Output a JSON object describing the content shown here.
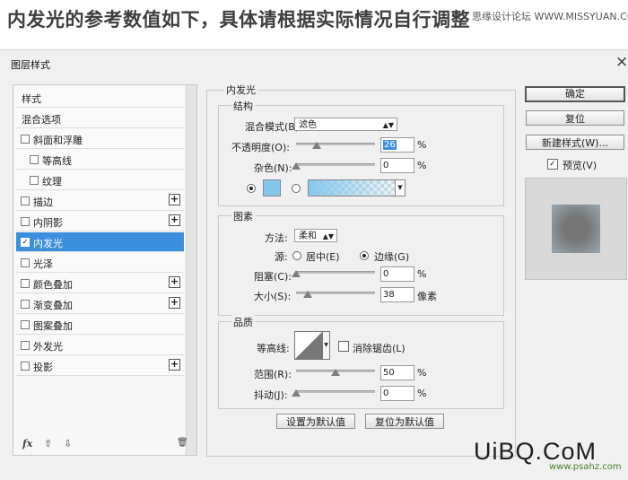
{
  "headline": "内发光的参考数值如下，具体请根据实际情况自行调整",
  "source": "思缘设计论坛 WWW.MISSYUAN.COM",
  "dialog": {
    "title": "图层样式",
    "close": "×"
  },
  "style_list": {
    "items": [
      {
        "label": "样式"
      },
      {
        "label": "混合选项"
      },
      {
        "label": "斜面和浮雕"
      },
      {
        "label": "等高线"
      },
      {
        "label": "纹理"
      },
      {
        "label": "描边"
      },
      {
        "label": "内阴影"
      },
      {
        "label": "内发光"
      },
      {
        "label": "光泽"
      },
      {
        "label": "颜色叠加"
      },
      {
        "label": "渐变叠加"
      },
      {
        "label": "图案叠加"
      },
      {
        "label": "外发光"
      },
      {
        "label": "投影"
      }
    ],
    "plus": "+",
    "checkmark": "✓",
    "footer": {
      "fx": "fx",
      "up": "⇧",
      "down": "⇩",
      "trash": "🗑"
    }
  },
  "inner_glow": {
    "section_title": "内发光",
    "structure": {
      "title": "结构",
      "blend_mode_label": "混合模式(B):",
      "blend_mode_value": "滤色",
      "opacity_label": "不透明度(O):",
      "opacity_value": "26",
      "opacity_fraction": 0.26,
      "noise_label": "杂色(N):",
      "noise_value": "0",
      "noise_fraction": 0,
      "percent": "%",
      "glow_color": "#84c7ec",
      "gradient_color": "#84c7ec"
    },
    "elements": {
      "title": "图素",
      "technique_label": "方法:",
      "technique_value": "柔和",
      "source_label": "源:",
      "source_center": "居中(E)",
      "source_edge": "边缘(G)",
      "choke_label": "阻塞(C):",
      "choke_value": "0",
      "choke_fraction": 0,
      "size_label": "大小(S):",
      "size_value": "38",
      "size_fraction": 0.15,
      "size_unit": "像素",
      "percent": "%"
    },
    "quality": {
      "title": "品质",
      "contour_label": "等高线:",
      "antialias_label": "消除锯齿(L)",
      "range_label": "范围(R):",
      "range_value": "50",
      "range_fraction": 0.5,
      "jitter_label": "抖动(J):",
      "jitter_value": "0",
      "jitter_fraction": 0,
      "percent": "%"
    },
    "make_default": "设置为默认值",
    "reset_default": "复位为默认值"
  },
  "right_panel": {
    "ok": "确定",
    "reset": "复位",
    "new_style": "新建样式(W)...",
    "preview_label": "预览(V)",
    "checkmark": "✓"
  },
  "watermark": {
    "text": "UiBQ.CoM",
    "sub": "www.psahz.com"
  }
}
